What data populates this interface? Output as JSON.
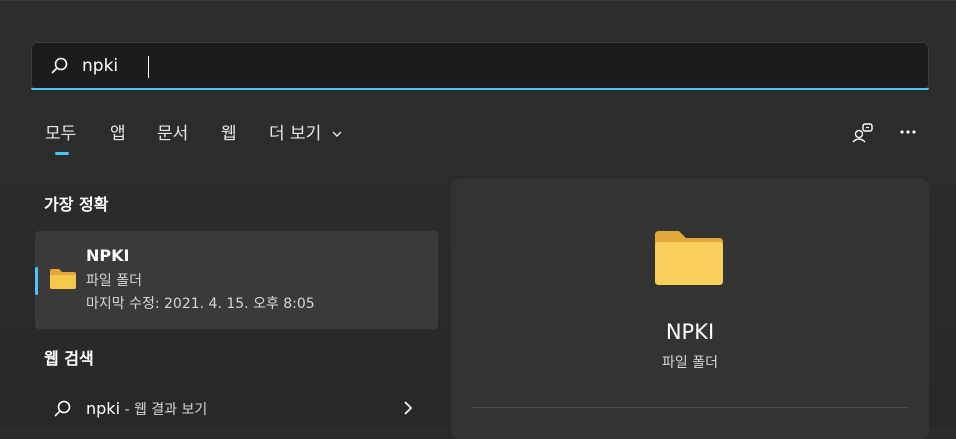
{
  "search": {
    "value": "npki",
    "icon": "search-icon"
  },
  "tabs": [
    {
      "label": "모두",
      "active": true
    },
    {
      "label": "앱",
      "active": false
    },
    {
      "label": "문서",
      "active": false
    },
    {
      "label": "웹",
      "active": false
    },
    {
      "label": "더 보기",
      "active": false
    }
  ],
  "toolbar": {
    "account_icon": "account-switch-icon",
    "more_icon": "more-options-icon"
  },
  "best_match": {
    "section_title": "가장 정확",
    "name": "NPKI",
    "type": "파일 폴더",
    "modified": "마지막 수정: 2021. 4. 15. 오후 8:05"
  },
  "web_search": {
    "section_title": "웹 검색",
    "term": "npki",
    "suffix": " - 웹 결과 보기"
  },
  "preview": {
    "name": "NPKI",
    "type": "파일 폴더"
  },
  "colors": {
    "accent": "#4cc2ff",
    "folder": "#f5c84c"
  }
}
